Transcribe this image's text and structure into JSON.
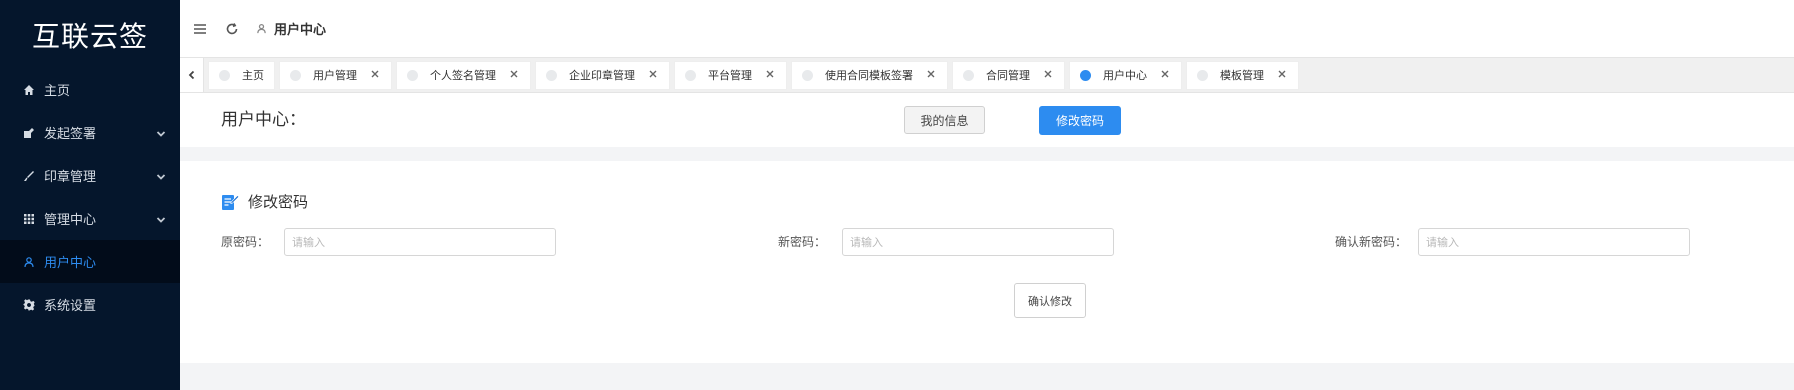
{
  "sidebar": {
    "logo": "互联云签",
    "items": [
      {
        "label": "主页",
        "icon": "home-icon",
        "expandable": false,
        "active": false
      },
      {
        "label": "发起签署",
        "icon": "sign-icon",
        "expandable": true,
        "active": false
      },
      {
        "label": "印章管理",
        "icon": "brush-icon",
        "expandable": true,
        "active": false
      },
      {
        "label": "管理中心",
        "icon": "grid-icon",
        "expandable": true,
        "active": false
      },
      {
        "label": "用户中心",
        "icon": "user-icon",
        "expandable": false,
        "active": true
      },
      {
        "label": "系统设置",
        "icon": "gear-icon",
        "expandable": false,
        "active": false
      }
    ]
  },
  "header": {
    "breadcrumb": "用户中心"
  },
  "tabs": [
    {
      "label": "主页",
      "closable": false,
      "active": false
    },
    {
      "label": "用户管理",
      "closable": true,
      "active": false
    },
    {
      "label": "个人签名管理",
      "closable": true,
      "active": false
    },
    {
      "label": "企业印章管理",
      "closable": true,
      "active": false
    },
    {
      "label": "平台管理",
      "closable": true,
      "active": false
    },
    {
      "label": "使用合同模板签署",
      "closable": true,
      "active": false
    },
    {
      "label": "合同管理",
      "closable": true,
      "active": false
    },
    {
      "label": "用户中心",
      "closable": true,
      "active": true
    },
    {
      "label": "模板管理",
      "closable": true,
      "active": false
    }
  ],
  "page": {
    "title": "用户中心：",
    "my_info_button": "我的信息",
    "change_password_button": "修改密码"
  },
  "form": {
    "section_title": "修改密码",
    "old_password_label": "原密码：",
    "new_password_label": "新密码：",
    "confirm_password_label": "确认新密码：",
    "placeholder": "请输入",
    "old_password_value": "",
    "new_password_value": "",
    "confirm_password_value": "",
    "submit_button": "确认修改"
  },
  "colors": {
    "sidebar_bg": "#05162c",
    "accent": "#2d8cf0"
  }
}
